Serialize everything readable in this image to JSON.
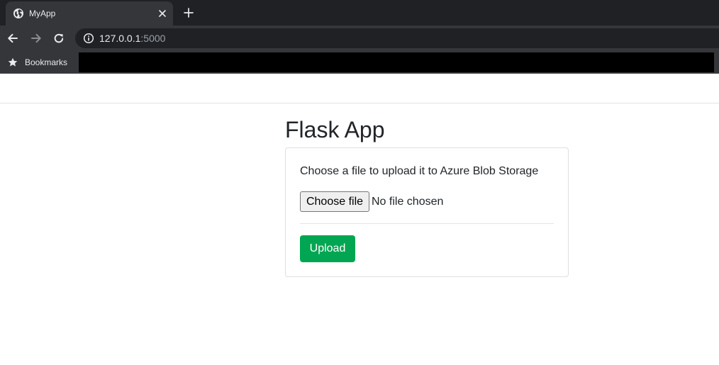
{
  "browser": {
    "tab": {
      "title": "MyApp"
    },
    "address_bar": {
      "host": "127.0.0.1",
      "port": ":5000"
    },
    "bookmarks_bar": {
      "label": "Bookmarks"
    }
  },
  "page": {
    "title": "Flask App",
    "card": {
      "instruction": "Choose a file to upload it to Azure Blob Storage",
      "file_button_label": "Choose file",
      "file_status": "No file chosen",
      "upload_button_label": "Upload"
    }
  },
  "colors": {
    "chrome_dark": "#202124",
    "chrome_toolbar": "#35363a",
    "upload_button": "#00a651"
  },
  "icons": {
    "tab_favicon": "globe-icon",
    "tab_close": "close-icon",
    "new_tab": "plus-icon",
    "back": "arrow-left-icon",
    "forward": "arrow-right-icon",
    "reload": "reload-icon",
    "site_info": "info-icon",
    "bookmarks": "star-icon"
  }
}
